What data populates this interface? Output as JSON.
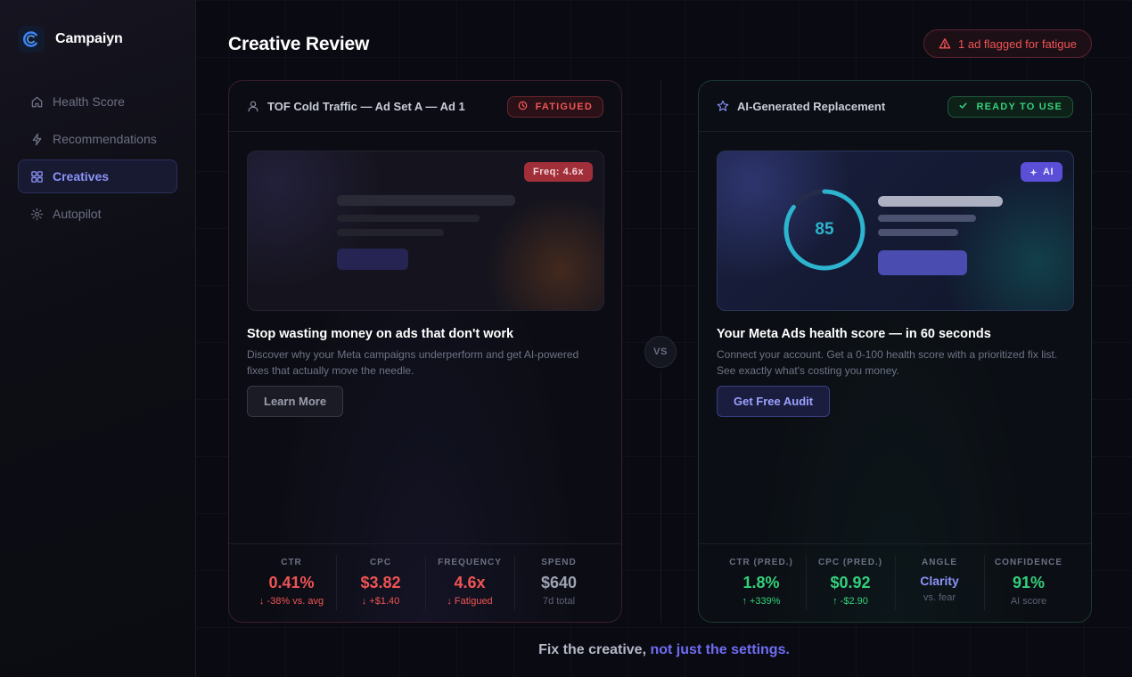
{
  "brand": {
    "name": "Campaiyn",
    "logo_icon": "c-logo-icon"
  },
  "sidebar": {
    "items": [
      {
        "label": "Health Score",
        "icon": "home-icon",
        "active": false
      },
      {
        "label": "Recommendations",
        "icon": "bolt-icon",
        "active": false
      },
      {
        "label": "Creatives",
        "icon": "grid-icon",
        "active": true
      },
      {
        "label": "Autopilot",
        "icon": "gear-icon",
        "active": false
      }
    ]
  },
  "header": {
    "title": "Creative Review",
    "flag_badge": "1 ad flagged for fatigue"
  },
  "left_card": {
    "title": "TOF Cold Traffic — Ad Set A — Ad 1",
    "status": "FATIGUED",
    "preview_pill": "Freq: 4.6x",
    "headline": "Stop wasting money on ads that don't work",
    "description": "Discover why your Meta campaigns underperform and get AI-powered fixes that actually move the needle.",
    "cta": "Learn More",
    "metrics": [
      {
        "label": "CTR",
        "value": "0.41%",
        "sub": "↓ -38% vs. avg"
      },
      {
        "label": "CPC",
        "value": "$3.82",
        "sub": "↓ +$1.40"
      },
      {
        "label": "FREQUENCY",
        "value": "4.6x",
        "sub": "↓ Fatigued"
      },
      {
        "label": "SPEND",
        "value": "$640",
        "sub": "7d total"
      }
    ]
  },
  "right_card": {
    "title": "AI-Generated Replacement",
    "status": "READY TO USE",
    "preview_pill": "AI",
    "score": "85",
    "score_fraction": 0.85,
    "headline": "Your Meta Ads health score — in 60 seconds",
    "description": "Connect your account. Get a 0-100 health score with a prioritized fix list. See exactly what's costing you money.",
    "cta": "Get Free Audit",
    "metrics": [
      {
        "label": "CTR (PRED.)",
        "value": "1.8%",
        "sub": "↑ +339%"
      },
      {
        "label": "CPC (PRED.)",
        "value": "$0.92",
        "sub": "↑ -$2.90"
      },
      {
        "label": "ANGLE",
        "value": "Clarity",
        "sub": "vs. fear"
      },
      {
        "label": "CONFIDENCE",
        "value": "91%",
        "sub": "AI score"
      }
    ]
  },
  "vs_label": "VS",
  "tagline": {
    "part1": "Fix the creative, ",
    "part2": "not just the settings."
  },
  "colors": {
    "accent": "#8b93f8",
    "danger": "#f05454",
    "success": "#34d07a",
    "gauge": "#2db4cf"
  }
}
